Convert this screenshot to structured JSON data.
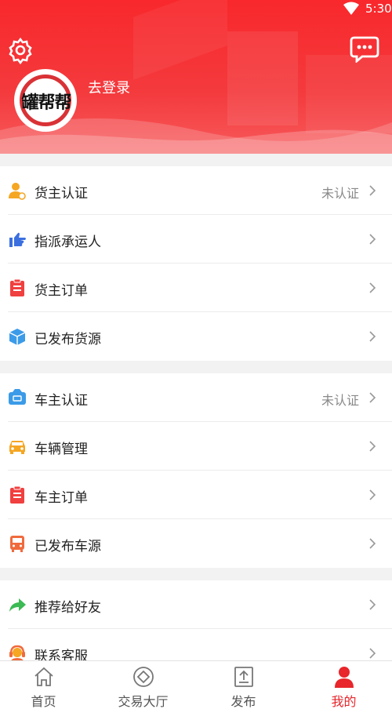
{
  "status_bar": {
    "time": "5:30"
  },
  "header": {
    "login_text": "去登录",
    "logo_text": "罐帮帮",
    "bg_color": "#f43a3d"
  },
  "sections": [
    {
      "items": [
        {
          "label": "货主认证",
          "status": "未认证",
          "icon": "person-badge-icon"
        },
        {
          "label": "指派承运人",
          "icon": "pointing-hand-icon"
        },
        {
          "label": "货主订单",
          "icon": "clipboard-icon"
        },
        {
          "label": "已发布货源",
          "icon": "package-icon"
        }
      ]
    },
    {
      "items": [
        {
          "label": "车主认证",
          "status": "未认证",
          "icon": "license-card-icon"
        },
        {
          "label": "车辆管理",
          "icon": "car-icon"
        },
        {
          "label": "车主订单",
          "icon": "clipboard-icon"
        },
        {
          "label": "已发布车源",
          "icon": "bus-icon"
        }
      ]
    },
    {
      "items": [
        {
          "label": "推荐给好友",
          "icon": "share-arrow-icon"
        },
        {
          "label": "联系客服",
          "icon": "headset-icon"
        }
      ]
    }
  ],
  "tabbar": {
    "tabs": [
      {
        "label": "首页",
        "icon": "home-icon"
      },
      {
        "label": "交易大厅",
        "icon": "trade-hall-icon"
      },
      {
        "label": "发布",
        "icon": "upload-icon"
      },
      {
        "label": "我的",
        "icon": "profile-icon",
        "active": true
      }
    ],
    "active_color": "#e8262b"
  }
}
